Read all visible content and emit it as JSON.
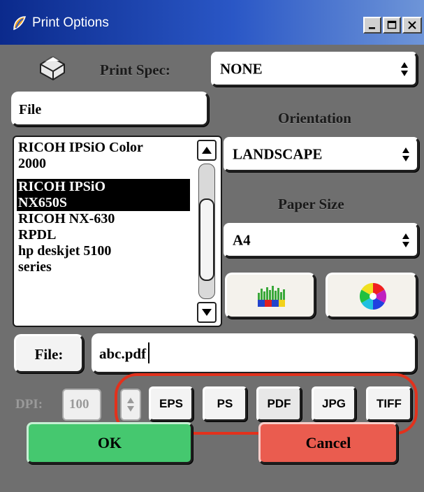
{
  "window": {
    "title": "Print Options",
    "controls": [
      "minimize-icon",
      "maximize-icon",
      "close-icon"
    ]
  },
  "print_spec": {
    "label": "Print Spec:",
    "value": "NONE"
  },
  "destination": {
    "value": "File"
  },
  "printers": {
    "items": [
      {
        "line1": "RICOH IPSiO Color",
        "line2": "2000",
        "selected": false
      },
      {
        "line1": "RICOH IPSiO",
        "line2": "NX650S",
        "selected": true
      },
      {
        "line1": "RICOH NX-630",
        "line2": "RPDL",
        "selected": false
      },
      {
        "line1": "hp deskjet 5100",
        "line2": "series",
        "selected": false
      }
    ]
  },
  "orientation": {
    "label": "Orientation",
    "value": "LANDSCAPE"
  },
  "paper_size": {
    "label": "Paper Size",
    "value": "A4"
  },
  "icons": {
    "color_bars": "color-bars-icon",
    "color_wheel": "color-wheel-icon",
    "printer": "printer-icon",
    "app": "app-logo-icon"
  },
  "file": {
    "button_label": "File:",
    "value": "abc.pdf"
  },
  "dpi": {
    "label": "DPI:",
    "value": "100"
  },
  "formats": [
    "EPS",
    "PS",
    "PDF",
    "JPG",
    "TIFF"
  ],
  "actions": {
    "ok_label": "OK",
    "cancel_label": "Cancel"
  },
  "colors": {
    "ok": "#45c86f",
    "cancel": "#ea5c4f",
    "highlight": "#e2311c",
    "titlebar": "#0b2a8c"
  }
}
